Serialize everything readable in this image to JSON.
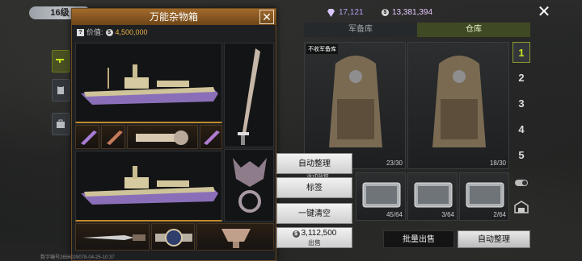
{
  "player": {
    "level": "16级"
  },
  "popup": {
    "title": "万能杂物箱",
    "price_label": "价值:",
    "price_value": "4,500,000"
  },
  "currency": {
    "gems": "17,121",
    "coins": "13,381,394"
  },
  "tabs": [
    {
      "label": "军备库",
      "active": false
    },
    {
      "label": "仓库",
      "active": true
    }
  ],
  "warehouse": {
    "tag": "不收军备库",
    "items": [
      {
        "name": "backpack",
        "count": "23/30"
      },
      {
        "name": "backpack",
        "count": "18/30"
      },
      {
        "name": "case",
        "count": "45/64"
      },
      {
        "name": "case",
        "count": "3/64"
      },
      {
        "name": "case",
        "count": "2/64"
      }
    ],
    "partial_label": "活动背包"
  },
  "page_tabs": [
    "1",
    "2",
    "3",
    "4",
    "5"
  ],
  "context_menu": {
    "auto_sort": "自动整理",
    "tag": "标签",
    "clear": "一键清空",
    "sell_amount": "3,112,500",
    "sell_label": "出售"
  },
  "actions": {
    "bulk_sell": "批量出售",
    "auto_sort": "自动整理"
  },
  "footer": {
    "note": "数字编号2656029078-04-25-10:37"
  },
  "colors": {
    "accent": "#c6e021",
    "popup_header": "#a26a2c",
    "price": "#e9b24a"
  }
}
